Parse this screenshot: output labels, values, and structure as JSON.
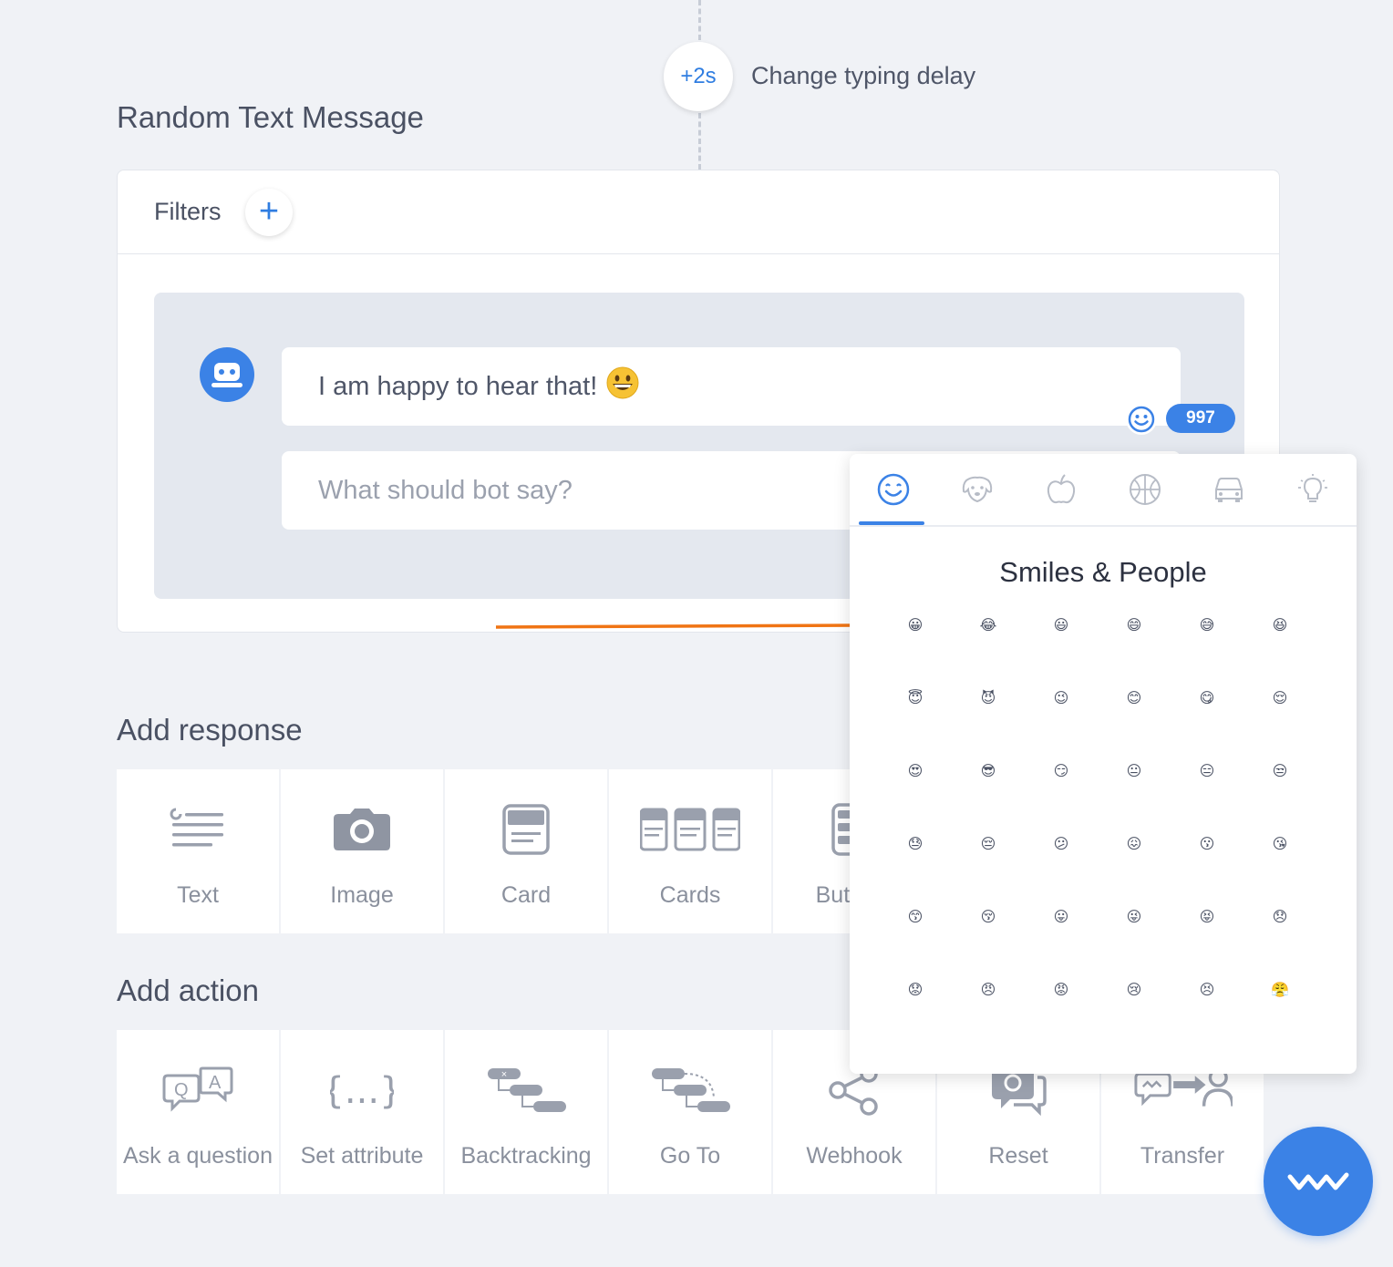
{
  "typing_delay": {
    "badge": "+2s",
    "label": "Change typing delay"
  },
  "block": {
    "title": "Random Text Message"
  },
  "filters": {
    "label": "Filters",
    "add_symbol": "+"
  },
  "message": {
    "text": "I am happy to hear that!",
    "placeholder": "What should bot say?",
    "char_count": "997"
  },
  "add_response": {
    "title": "Add response",
    "items": [
      {
        "label": "Text",
        "icon": "text-lines-icon"
      },
      {
        "label": "Image",
        "icon": "camera-icon"
      },
      {
        "label": "Card",
        "icon": "card-icon"
      },
      {
        "label": "Cards",
        "icon": "cards-icon"
      },
      {
        "label": "Buttons",
        "icon": "buttons-icon"
      }
    ]
  },
  "add_action": {
    "title": "Add action",
    "items": [
      {
        "label": "Ask a question",
        "icon": "qa-icon"
      },
      {
        "label": "Set attribute",
        "icon": "braces-icon"
      },
      {
        "label": "Backtracking",
        "icon": "backtracking-icon"
      },
      {
        "label": "Go To",
        "icon": "goto-icon"
      },
      {
        "label": "Webhook",
        "icon": "webhook-icon"
      },
      {
        "label": "Reset",
        "icon": "reset-icon"
      },
      {
        "label": "Transfer",
        "icon": "transfer-icon"
      }
    ]
  },
  "emoji_picker": {
    "title": "Smiles & People",
    "tabs": [
      "smiley-icon",
      "dog-icon",
      "apple-icon",
      "ball-icon",
      "car-icon",
      "bulb-icon"
    ],
    "active_tab": "smiley-icon",
    "emojis": [
      "😀",
      "😂",
      "😃",
      "😄",
      "😅",
      "😆",
      "😇",
      "😈",
      "😉",
      "😊",
      "😋",
      "😌",
      "😍",
      "😎",
      "😏",
      "😐",
      "😑",
      "😒",
      "😓",
      "😔",
      "😕",
      "😖",
      "😗",
      "😘",
      "😙",
      "😚",
      "😛",
      "😜",
      "😝",
      "😞",
      "😟",
      "😠",
      "😡",
      "😢",
      "😣",
      "😤",
      "😥",
      "😦",
      "😧",
      "😨",
      "😩",
      "😪"
    ]
  },
  "colors": {
    "accent": "#3b82e6",
    "arrow": "#f07414",
    "background": "#f0f2f6"
  }
}
